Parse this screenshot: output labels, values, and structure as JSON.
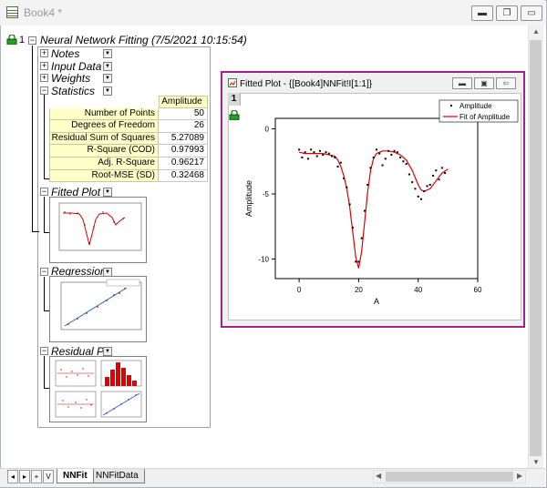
{
  "window": {
    "title": "Book4 *",
    "minimize_icon": "minimize-icon",
    "restore_icon": "restore-icon",
    "close_icon": "close-icon"
  },
  "tree": {
    "index": "1",
    "root_label": "Neural Network Fitting (7/5/2021 10:15:54)",
    "nodes": [
      "Notes",
      "Input Data",
      "Weights",
      "Statistics"
    ],
    "graph_nodes": [
      "Fitted Plot",
      "Regression",
      "Residual Pl"
    ]
  },
  "statistics": {
    "column_header": "Amplitude",
    "rows": [
      {
        "name": "Number of Points",
        "value": "50"
      },
      {
        "name": "Degrees of Freedom",
        "value": "26"
      },
      {
        "name": "Residual Sum of Squares",
        "value": "5.27089"
      },
      {
        "name": "R-Square (COD)",
        "value": "0.97993"
      },
      {
        "name": "Adj. R-Square",
        "value": "0.96217"
      },
      {
        "name": "Root-MSE (SD)",
        "value": "0.32468"
      }
    ]
  },
  "fitted_plot_window": {
    "title": "Fitted Plot - {[Book4]NNFit!I[1:1]}",
    "layer_label": "1"
  },
  "sheets": {
    "tabs": [
      "NNFit",
      "NNFitData"
    ],
    "active": "NNFit",
    "nav": [
      "◂",
      "▸",
      "+",
      "V"
    ]
  },
  "chart_data": {
    "type": "scatter",
    "xlabel": "A",
    "ylabel": "Amplitude",
    "xlim": [
      -8,
      60
    ],
    "ylim": [
      -11.5,
      0.8
    ],
    "xticks": [
      0,
      20,
      40,
      60
    ],
    "yticks": [
      0,
      -5,
      -10
    ],
    "legend": [
      "Amplitude",
      "Fit of Amplitude"
    ],
    "legend_placement": "top-right",
    "colors": {
      "data": "#000000",
      "fit": "#e00000"
    },
    "series": [
      {
        "name": "Amplitude",
        "x": [
          0,
          1,
          2,
          3,
          4,
          5,
          6,
          7,
          8,
          9,
          10,
          11,
          12,
          13,
          14,
          15,
          16,
          17,
          18,
          19,
          20,
          21,
          22,
          23,
          24,
          25,
          26,
          27,
          28,
          29,
          30,
          31,
          32,
          33,
          34,
          35,
          36,
          37,
          38,
          39,
          40,
          41,
          42,
          43,
          44,
          45,
          46,
          47,
          48,
          49
        ],
        "y": [
          -1.6,
          -2.2,
          -1.8,
          -2.3,
          -1.6,
          -1.8,
          -2.1,
          -1.7,
          -2.0,
          -1.8,
          -1.9,
          -2.1,
          -2.2,
          -2.9,
          -2.6,
          -3.8,
          -4.5,
          -5.8,
          -7.6,
          -10.2,
          -10.2,
          -8.4,
          -6.3,
          -4.3,
          -3.0,
          -2.2,
          -1.6,
          -1.9,
          -2.8,
          -2.3,
          -1.7,
          -2.0,
          -1.7,
          -1.8,
          -2.2,
          -2.5,
          -2.7,
          -3.5,
          -4.1,
          -4.6,
          -5.2,
          -5.4,
          -4.8,
          -4.4,
          -4.3,
          -3.6,
          -3.2,
          -3.9,
          -3.0,
          -3.4
        ]
      },
      {
        "name": "Fit of Amplitude",
        "x": [
          0,
          2,
          4,
          6,
          8,
          10,
          12,
          13,
          14,
          15,
          16,
          17,
          18,
          19,
          20,
          21,
          22,
          23,
          24,
          25,
          26,
          28,
          30,
          32,
          34,
          36,
          38,
          40,
          41,
          42,
          44,
          46,
          48,
          50
        ],
        "y": [
          -1.8,
          -1.9,
          -1.9,
          -1.9,
          -1.9,
          -2.0,
          -2.1,
          -2.4,
          -2.9,
          -3.6,
          -4.6,
          -6.0,
          -7.9,
          -9.8,
          -10.7,
          -9.4,
          -7.2,
          -4.9,
          -3.2,
          -2.3,
          -1.9,
          -1.7,
          -1.7,
          -1.8,
          -2.0,
          -2.4,
          -3.2,
          -4.3,
          -4.7,
          -4.8,
          -4.6,
          -4.0,
          -3.4,
          -3.1
        ]
      }
    ]
  }
}
